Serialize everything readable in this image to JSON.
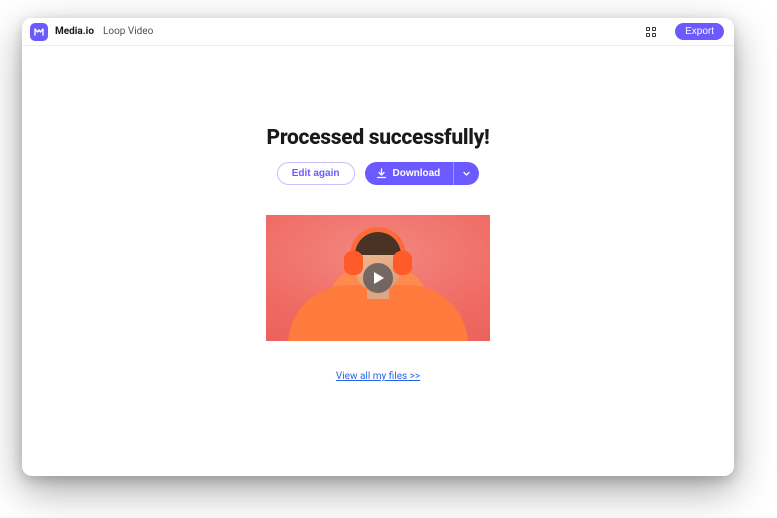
{
  "header": {
    "brand": "Media.io",
    "tool_name": "Loop Video",
    "export_label": "Export"
  },
  "main": {
    "title": "Processed successfully!",
    "edit_label": "Edit again",
    "download_label": "Download",
    "view_files_link": "View all my files >>"
  },
  "colors": {
    "accent": "#6a5aff",
    "link": "#2563eb"
  }
}
